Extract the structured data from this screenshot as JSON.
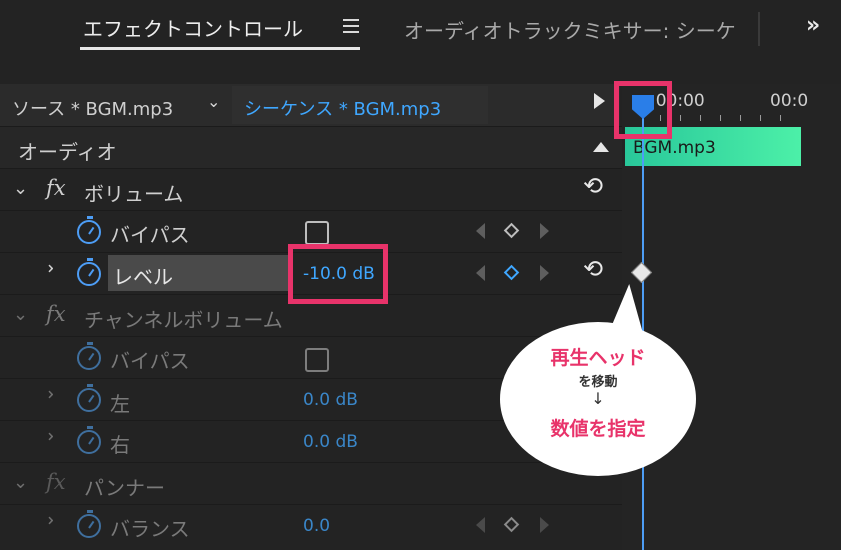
{
  "tabs": {
    "active": "エフェクトコントロール",
    "inactive": "オーディオトラックミキサー: シーケ",
    "overflow": "»"
  },
  "source": {
    "label": "ソース * BGM.mp3",
    "sequence": "シーケンス * BGM.mp3"
  },
  "timeline": {
    "ruler_left": ":00:00",
    "ruler_right": "00:0",
    "clip_name": "BGM.mp3"
  },
  "sections": {
    "audio": "オーディオ",
    "volume": "ボリューム",
    "channel_volume": "チャンネルボリューム",
    "panner": "パンナー"
  },
  "params": {
    "bypass": "バイパス",
    "level": "レベル",
    "level_value": "-10.0 dB",
    "bypass2": "バイパス",
    "left": "左",
    "left_value": "0.0 dB",
    "right": "右",
    "right_value": "0.0 dB",
    "balance": "バランス",
    "balance_value": "0.0"
  },
  "fx_label": "fx",
  "callout": {
    "line1": "再生ヘッド",
    "line2": "を移動",
    "arrow": "↓",
    "line3": "数値を指定"
  },
  "colors": {
    "accent_blue": "#3fa7ff",
    "highlight_pink": "#e8336a",
    "clip_green": "#4cf0a8"
  }
}
